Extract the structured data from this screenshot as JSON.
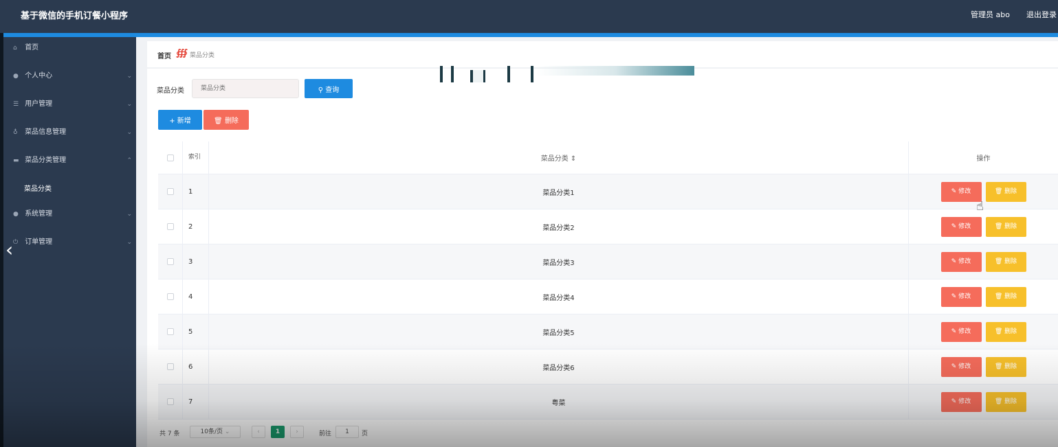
{
  "header": {
    "title": "基于微信的手机订餐小程序",
    "user": "管理员 abo",
    "logout": "退出登录"
  },
  "sidebar": {
    "items": [
      {
        "icon": "home-icon",
        "label": "首页"
      },
      {
        "icon": "person-icon",
        "label": "个人中心",
        "arrow": "down"
      },
      {
        "icon": "menu-icon",
        "label": "用户管理",
        "arrow": "down"
      },
      {
        "icon": "bulb-icon",
        "label": "菜品信息管理",
        "arrow": "down"
      },
      {
        "icon": "card-icon",
        "label": "菜品分类管理",
        "arrow": "up"
      },
      {
        "icon": "person-icon",
        "label": "系统管理",
        "arrow": "down"
      },
      {
        "icon": "power-icon",
        "label": "订单管理",
        "arrow": "down"
      }
    ],
    "submenu": "菜品分类"
  },
  "breadcrumb": {
    "home": "首页",
    "current": "菜品分类"
  },
  "filter": {
    "label": "菜品分类",
    "placeholder": "菜品分类",
    "query_button": "查询"
  },
  "toolbar": {
    "add_button": "新增",
    "delete_button": "删除"
  },
  "table": {
    "headers": {
      "index": "索引",
      "name": "菜品分类 ⇕",
      "ops": "操作"
    },
    "rows": [
      {
        "idx": "1",
        "name": "菜品分类1"
      },
      {
        "idx": "2",
        "name": "菜品分类2"
      },
      {
        "idx": "3",
        "name": "菜品分类3"
      },
      {
        "idx": "4",
        "name": "菜品分类4"
      },
      {
        "idx": "5",
        "name": "菜品分类5"
      },
      {
        "idx": "6",
        "name": "菜品分类6"
      },
      {
        "idx": "7",
        "name": "粤菜"
      }
    ],
    "edit_label": "修改",
    "delete_label": "删除"
  },
  "pagination": {
    "total": "共 7 条",
    "page_size": "10条/页",
    "page": "1",
    "goto_label": "前往",
    "goto_value": "1",
    "page_unit": "页"
  }
}
